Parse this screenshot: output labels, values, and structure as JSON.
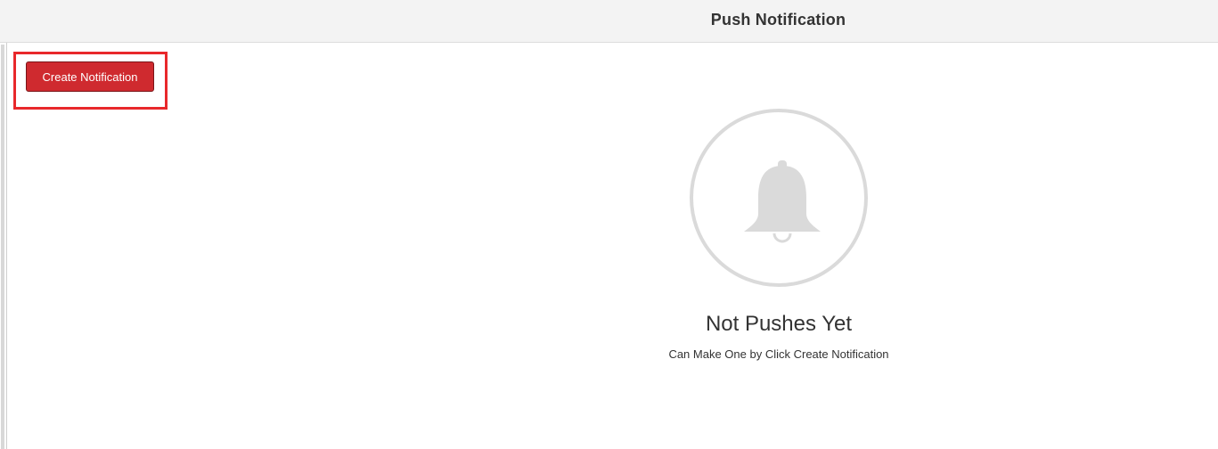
{
  "header": {
    "title": "Push Notification"
  },
  "toolbar": {
    "create_label": "Create Notification"
  },
  "empty_state": {
    "icon": "bell-icon",
    "title": "Not Pushes Yet",
    "subtitle": "Can Make One by Click Create Notification"
  },
  "colors": {
    "accent": "#cf2a2f",
    "highlight": "#e8282b",
    "header_bg": "#f3f3f3",
    "icon_gray": "#dadada"
  }
}
